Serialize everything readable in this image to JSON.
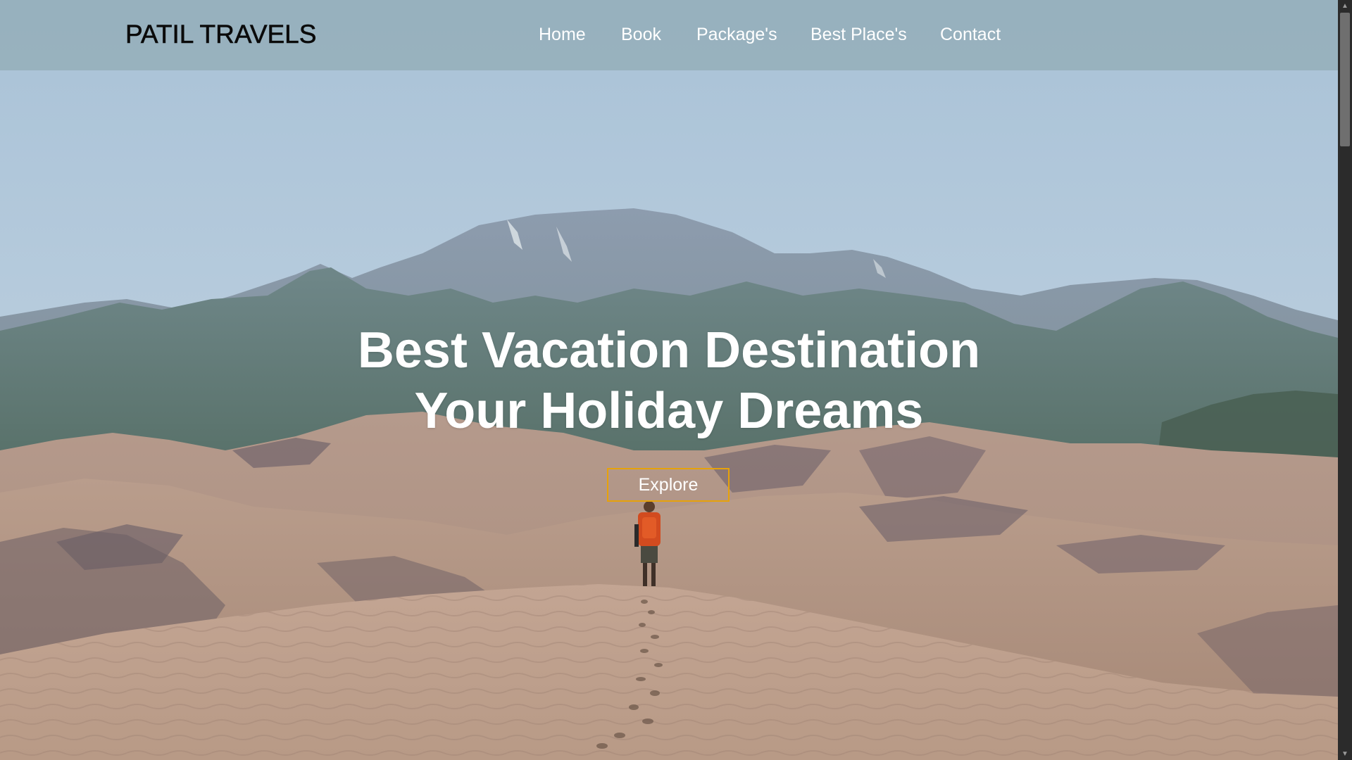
{
  "brand": {
    "name": "PATIL TRAVELS"
  },
  "nav": {
    "items": [
      {
        "label": "Home"
      },
      {
        "label": "Book"
      },
      {
        "label": "Package's"
      },
      {
        "label": "Best Place's"
      },
      {
        "label": "Contact"
      }
    ]
  },
  "hero": {
    "title_line1": "Best Vacation Destination",
    "title_line2": "Your Holiday Dreams",
    "cta_label": "Explore",
    "background": "desert-dunes-mountains-photo"
  },
  "icons": {
    "scroll_up": "▲",
    "scroll_down": "▼"
  },
  "colors": {
    "navbar": "#96b0bc",
    "cta_border": "#e7a20a",
    "text_light": "#ffffff",
    "brand_text": "#0a0a0a"
  }
}
